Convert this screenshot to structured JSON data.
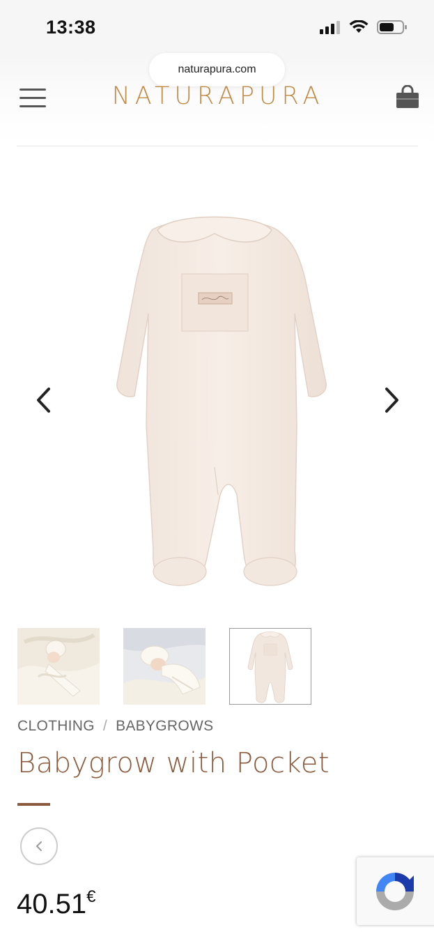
{
  "status_bar": {
    "time": "13:38"
  },
  "browser": {
    "url": "naturapura.com"
  },
  "header": {
    "logo": "NATURAPURA",
    "menu_icon": "hamburger-menu-icon",
    "cart_icon": "shopping-bag-icon"
  },
  "gallery": {
    "prev_icon": "chevron-left-icon",
    "next_icon": "chevron-right-icon",
    "thumbnail_count": 3,
    "active_thumbnail": 3
  },
  "breadcrumb": {
    "items": [
      "CLOTHING",
      "BABYGROWS"
    ],
    "separator": "/"
  },
  "product": {
    "title": "Babygrow with Pocket",
    "price": "40.51",
    "currency": "€"
  },
  "colors": {
    "brand_gold": "#c08a45",
    "title_brown": "#8b5a3c",
    "garment_cream": "#f5ebe3"
  }
}
